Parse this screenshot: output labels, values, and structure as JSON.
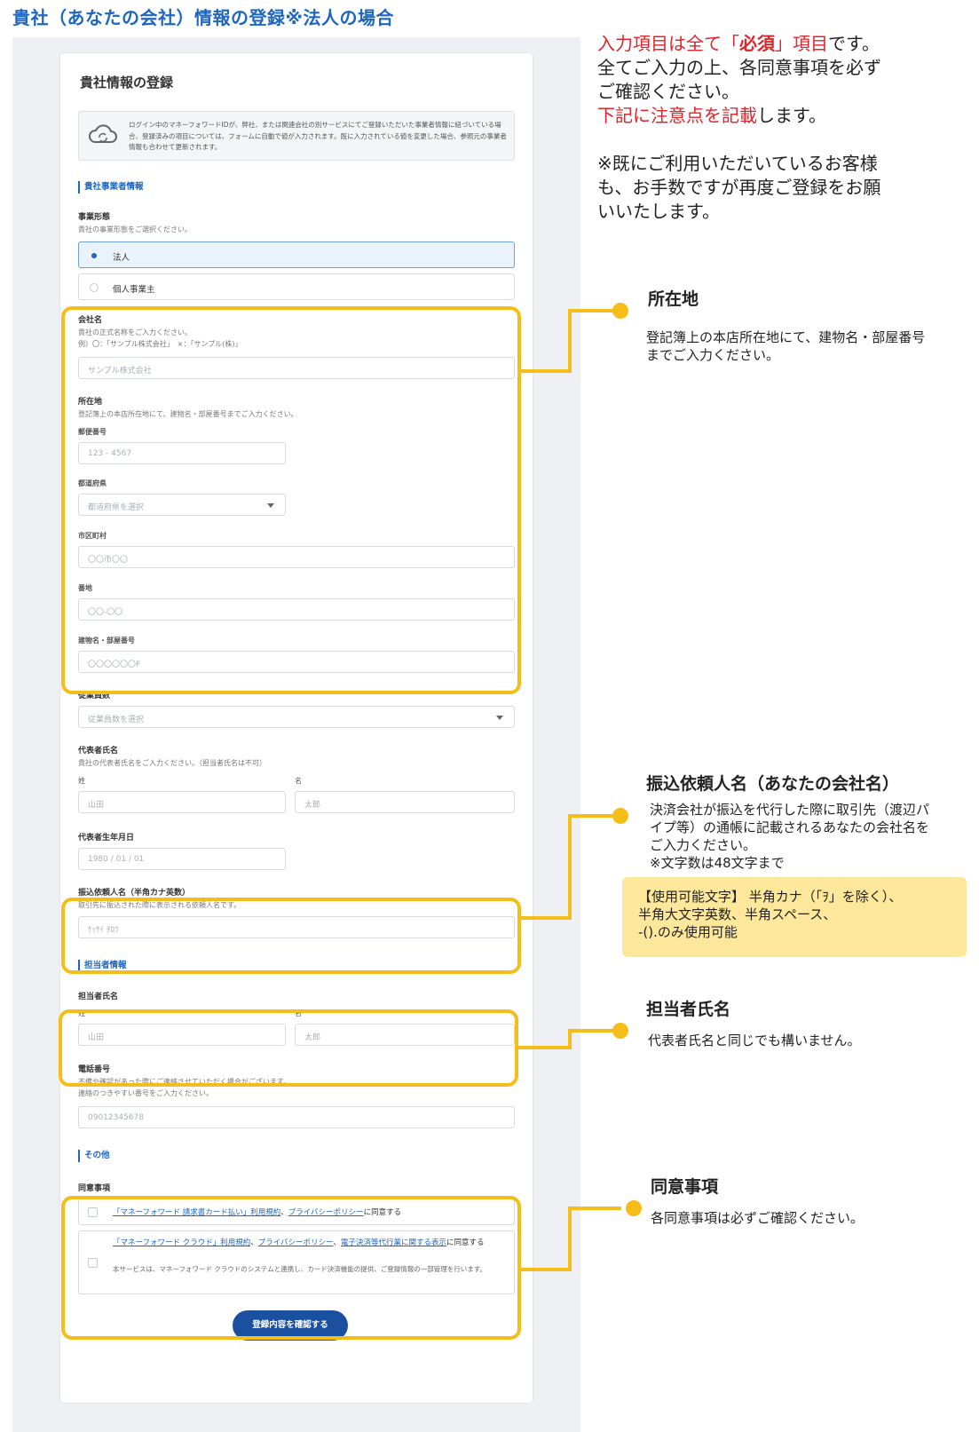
{
  "page_title": "貴社（あなたの会社）情報の登録※法人の場合",
  "form": {
    "title": "貴社情報の登録",
    "info_text": "ログイン中のマネーフォワードIDが、弊社、または関連会社の別サービスにてご登録いただいた事業者情報に紐づいている場合、登録済みの項目については、フォームに自動で値が入力されます。既に入力されている値を変更した場合、参照元の事業者情報も合わせて更新されます。",
    "section_business": "貴社事業者情報",
    "business_type": {
      "label": "事業形態",
      "hint": "貴社の事業形態をご選択ください。",
      "options": [
        "法人",
        "個人事業主"
      ],
      "selected": "法人"
    },
    "company_name": {
      "label": "会社名",
      "hint1": "貴社の正式名称をご入力ください。",
      "hint2": "例）〇：「サンプル株式会社」　×：「サンプル(株)」",
      "placeholder": "サンプル株式会社"
    },
    "address": {
      "label": "所在地",
      "hint": "登記簿上の本店所在地にて、建物名・部屋番号までご入力ください。",
      "postal_label": "郵便番号",
      "postal_placeholder": "123 - 4567",
      "pref_label": "都道府県",
      "pref_placeholder": "都道府県を選択",
      "city_label": "市区町村",
      "city_placeholder": "〇〇市〇〇",
      "street_label": "番地",
      "street_placeholder": "〇〇-〇〇",
      "building_label": "建物名・部屋番号",
      "building_placeholder": "〇〇〇〇〇〇F"
    },
    "employees": {
      "label": "従業員数",
      "placeholder": "従業員数を選択"
    },
    "representative": {
      "label": "代表者氏名",
      "hint": "貴社の代表者氏名をご入力ください。（担当者氏名は不可）",
      "last_label": "姓",
      "first_label": "名",
      "last_placeholder": "山田",
      "first_placeholder": "太郎"
    },
    "birth": {
      "label": "代表者生年月日",
      "placeholder": "1980 / 01 / 01"
    },
    "transfer_name": {
      "label": "振込依頼人名（半角カナ英数）",
      "hint": "取引先に振込された際に表示される依頼人名です。",
      "placeholder": "ｹｯｻｲ ﾀﾛｳ"
    },
    "section_contact": "担当者情報",
    "contact_name": {
      "label": "担当者氏名",
      "last_label": "姓",
      "first_label": "名",
      "last_placeholder": "山田",
      "first_placeholder": "太郎"
    },
    "phone": {
      "label": "電話番号",
      "hint1": "不備や確認があった際にご連絡させていただく場合がございます。",
      "hint2": "連絡のつきやすい番号をご入力ください。",
      "placeholder": "09012345678"
    },
    "section_other": "その他",
    "agreements": {
      "label": "同意事項",
      "item1_link1": "「マネーフォワード 請求書カード払い」利用規約",
      "item1_sep": "、",
      "item1_link2": "プライバシーポリシー",
      "item1_suffix": "に同意する",
      "item2_link1": "「マネーフォワード クラウド」利用規約",
      "item2_sep1": "、",
      "item2_link2": "プライバシーポリシー",
      "item2_sep2": "、",
      "item2_link3": "電子決済等代行業に関する表示",
      "item2_suffix": "に同意する",
      "item2_note": "本サービスは、マネーフォワード クラウドのシステムと連携し、カード決済機能の提供、ご登録情報の一部管理を行います。"
    },
    "submit_label": "登録内容を確認する"
  },
  "intro": {
    "line1_red": "入力項目は全て「",
    "line1_bold": "必須",
    "line1_red2": "」項目",
    "line1_rest": "です。",
    "line2": "全てご入力の上、各同意事項を必ず",
    "line3": "ご確認ください。",
    "line4_red": "下記に注意点を記載",
    "line4_rest": "します。",
    "line5": "※既にご利用いただいているお客様",
    "line6": "も、お手数ですが再度ご登録をお願",
    "line7": "いいたします。"
  },
  "annotations": {
    "address_title": "所在地",
    "address_text1": "登記簿上の本店所在地にて、建物名・部屋番号",
    "address_text2": "までご入力ください。",
    "transfer_title": "振込依頼人名（あなたの会社名）",
    "transfer_text1": "決済会社が振込を代行した際に取引先（渡辺パ",
    "transfer_text2": "イプ等）の通帳に記載されるあなたの会社名を",
    "transfer_text3": "ご入力ください。",
    "transfer_text4": "※文字数は48文字まで",
    "allowed_line1": "【使用可能文字】 半角カナ（「ｦ」を除く）、",
    "allowed_line2": "半角大文字英数、半角スペース、",
    "allowed_line3": "-().のみ使用可能",
    "contact_title": "担当者氏名",
    "contact_text": "代表者氏名と同じでも構いません。",
    "agree_title": "同意事項",
    "agree_text": "各同意事項は必ずご確認ください。"
  },
  "colors": {
    "accent_blue": "#1f66c1",
    "highlight_yellow": "#f5bd18",
    "note_yellow": "#fde79a",
    "required_red": "#e0242a",
    "submit_blue": "#1b4fa0"
  }
}
